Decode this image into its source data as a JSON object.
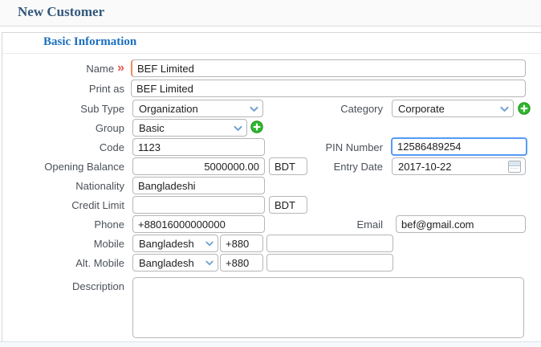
{
  "header": {
    "title": "New Customer"
  },
  "section": {
    "title": "Basic Information"
  },
  "colors": {
    "header_title": "#33587c",
    "section_title": "#1b6fc0",
    "required_marker": "#e8574c",
    "focus_border": "#569af8",
    "required_field_border": "#ef8a5e",
    "add_button_green": "#2eb82e",
    "select_chevron": "#6f9fd0"
  },
  "fields": {
    "name": {
      "label": "Name",
      "required_marker": "»",
      "value": "BEF Limited"
    },
    "print_as": {
      "label": "Print as",
      "value": "BEF Limited"
    },
    "sub_type": {
      "label": "Sub Type",
      "value": "Organization"
    },
    "category": {
      "label": "Category",
      "value": "Corporate"
    },
    "group": {
      "label": "Group",
      "value": "Basic"
    },
    "code": {
      "label": "Code",
      "value": "1123"
    },
    "pin": {
      "label": "PIN Number",
      "value": "12586489254"
    },
    "opening_balance": {
      "label": "Opening Balance",
      "value": "5000000.00",
      "currency": "BDT"
    },
    "entry_date": {
      "label": "Entry Date",
      "value": "2017-10-22"
    },
    "nationality": {
      "label": "Nationality",
      "value": "Bangladeshi"
    },
    "credit_limit": {
      "label": "Credit Limit",
      "value": "",
      "currency": "BDT"
    },
    "phone": {
      "label": "Phone",
      "value": "+88016000000000"
    },
    "email": {
      "label": "Email",
      "value": "bef@gmail.com"
    },
    "mobile": {
      "label": "Mobile",
      "country": "Bangladesh",
      "dial_code": "+880",
      "value": ""
    },
    "alt_mobile": {
      "label": "Alt. Mobile",
      "country": "Bangladesh",
      "dial_code": "+880",
      "value": ""
    },
    "description": {
      "label": "Description",
      "value": ""
    }
  }
}
